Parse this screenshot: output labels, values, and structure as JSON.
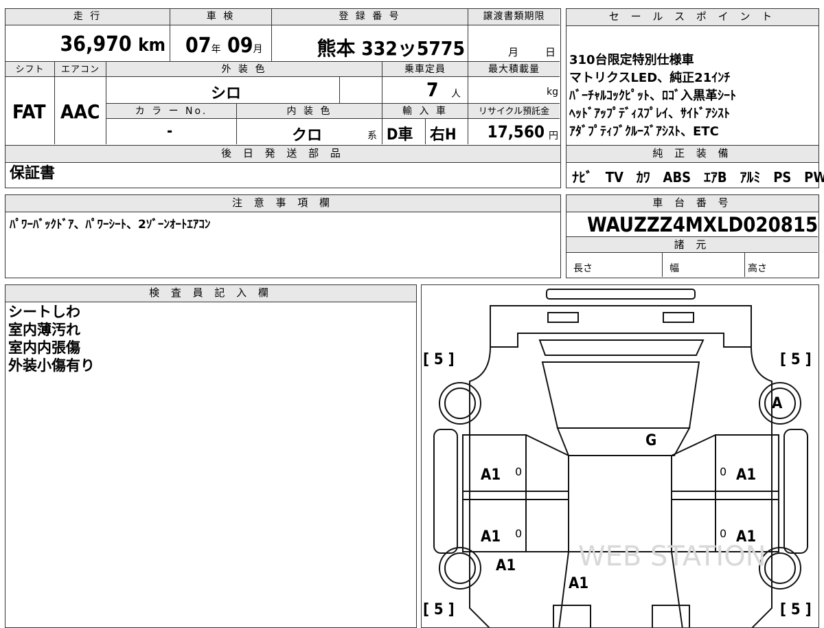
{
  "top_table": {
    "headers": {
      "mileage": "走 行",
      "inspection": "車 検",
      "registration": "登 録 番 号",
      "transfer_deadline": "譲渡書類期限"
    },
    "mileage_value": "36,970",
    "mileage_unit": "km",
    "inspection_year": "07",
    "inspection_year_unit": "年",
    "inspection_month": "09",
    "inspection_month_unit": "月",
    "registration_value": "熊本 332ッ5775",
    "transfer_month": "月",
    "transfer_day": "日",
    "headers2": {
      "shift": "シフト",
      "aircon": "エアコン",
      "exterior_color": "外 装 色",
      "capacity": "乗車定員",
      "max_load": "最大積載量"
    },
    "shift_value": "FAT",
    "aircon_value": "AAC",
    "exterior_color_value": "シロ",
    "capacity_value": "7",
    "capacity_unit": "人",
    "max_load_unit": "kg",
    "headers3": {
      "color_no": "カ ラ ー No.",
      "interior_color": "内 装 色",
      "import": "輸 入 車",
      "recycle": "リサイクル預託金"
    },
    "color_no_value": "-",
    "interior_color_value": "クロ",
    "interior_suffix": "系",
    "import_d": "D車",
    "import_h": "右H",
    "recycle_value": "17,560",
    "recycle_unit": "円"
  },
  "later_parts": {
    "header": "後 日 発 送 部 品",
    "value": "保証書"
  },
  "sales_points": {
    "header": "セ ー ル ス ポ イ ン ト",
    "lines": [
      "310台限定特別仕様車",
      "マトリクスLED、純正21ｲﾝﾁ",
      "ﾊﾞｰﾁｬﾙｺｯｸﾋﾟｯﾄ、ﾛｺﾞ入黒革ｼｰﾄ",
      "ﾍｯﾄﾞｱｯﾌﾟﾃﾞｨｽﾌﾟﾚｲ、ｻｲﾄﾞｱｼｽﾄ",
      "ｱﾀﾞﾌﾟﾃｨﾌﾞｸﾙｰｽﾞｱｼｽﾄ、ETC"
    ]
  },
  "equipment": {
    "header": "純 正 装 備",
    "items": [
      "ﾅﾋﾞ",
      "TV",
      "ｶﾜ",
      "ABS",
      "ｴｱB",
      "ｱﾙﾐ",
      "PS",
      "PW"
    ]
  },
  "notes": {
    "header": "注 意 事 項 欄",
    "value": "ﾊﾟﾜｰﾊﾞｯｸﾄﾞｱ、ﾊﾟﾜｰｼｰﾄ、2ｿﾞｰﾝｵｰﾄｴｱｺﾝ"
  },
  "chassis": {
    "header": "車 台 番 号",
    "value": "WAUZZZ4MXLD020815"
  },
  "specs": {
    "header": "諸 元",
    "length": "長さ",
    "width": "幅",
    "height": "高さ"
  },
  "inspector": {
    "header": "検 査 員 記 入 欄",
    "lines": [
      "シートしわ",
      "室内薄汚れ",
      "室内内張傷",
      "外装小傷有り"
    ]
  },
  "diagram": {
    "tire_left_top": "[ 5 ]",
    "tire_right_top": "[ 5 ]",
    "tire_left_bottom": "[ 5 ]",
    "tire_right_bottom": "[ 5 ]",
    "marks": [
      "A",
      "G",
      "A1",
      "A1",
      "A1",
      "A1",
      "A1",
      "A1"
    ],
    "zero": "0",
    "watermark": "WEB STATION"
  }
}
